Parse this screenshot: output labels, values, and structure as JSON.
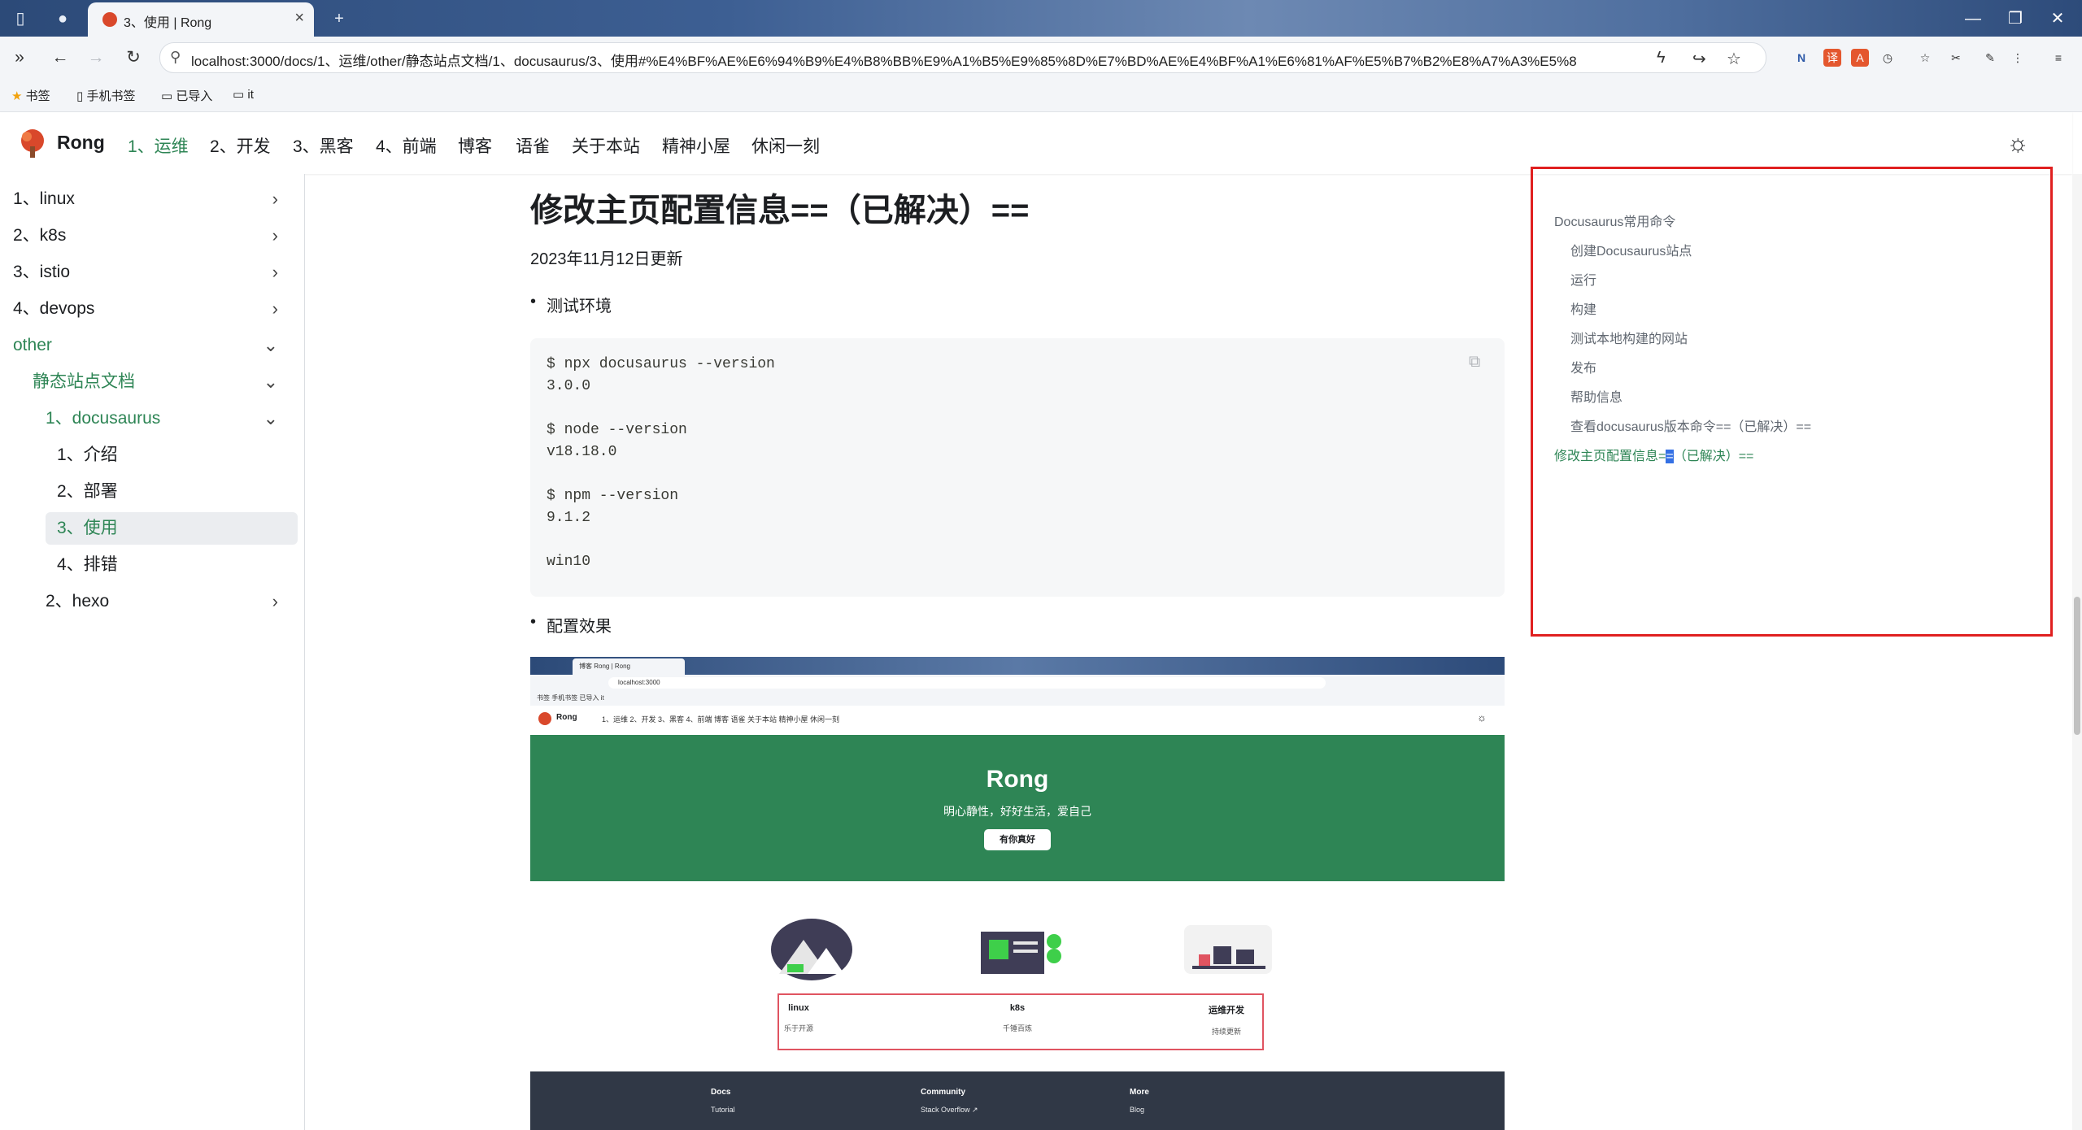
{
  "browser": {
    "tab_title": "3、使用 | Rong",
    "url": "localhost:3000/docs/1、运维/other/静态站点文档/1、docusaurus/3、使用#%E4%BF%AE%E6%94%B9%E4%B8%BB%E9%A1%B5%E9%85%8D%E7%BD%AE%E4%BF%A1%E6%81%AF%E5%B7%B2%E8%A7%A3%E5%8",
    "bookmarks": [
      "书签",
      "手机书签",
      "已导入",
      "it"
    ],
    "colors": {
      "tabbar": "#2c4a78",
      "toolbar": "#f3f5f8"
    }
  },
  "site": {
    "brand": "Rong",
    "nav": [
      "1、运维",
      "2、开发",
      "3、黑客",
      "4、前端",
      "博客",
      "语雀",
      "关于本站",
      "精神小屋",
      "休闲一刻"
    ],
    "accent": "#2e8555"
  },
  "sidebar": {
    "items": [
      {
        "label": "1、linux"
      },
      {
        "label": "2、k8s"
      },
      {
        "label": "3、istio"
      },
      {
        "label": "4、devops"
      },
      {
        "label": "other"
      },
      {
        "label": "静态站点文档"
      },
      {
        "label": "1、docusaurus"
      },
      {
        "label": "1、介绍"
      },
      {
        "label": "2、部署"
      },
      {
        "label": "3、使用"
      },
      {
        "label": "4、排错"
      },
      {
        "label": "2、hexo"
      }
    ]
  },
  "doc": {
    "heading": "修改主页配置信息==（已解决）==",
    "date": "2023年11月12日更新",
    "bullet1": "测试环境",
    "bullet2": "配置效果",
    "code_lines": [
      "$ npx docusaurus --version",
      "3.0.0",
      "",
      "$ node --version",
      "v18.18.0",
      "",
      "$ npm --version",
      "9.1.2",
      "",
      "win10"
    ]
  },
  "screenshot": {
    "tab": "博客 Rong | Rong",
    "url": "localhost:3000",
    "bookmarks": "书签   手机书签   已导入   it",
    "brand": "Rong",
    "nav": "1、运维    2、开发    3、黑客    4、前端    博客    语雀    关于本站    精神小屋    休闲一刻",
    "hero_title": "Rong",
    "hero_subtitle": "明心静性，好好生活，爱自己",
    "hero_button": "有你真好",
    "features": [
      {
        "title": "linux",
        "desc": "乐于开源"
      },
      {
        "title": "k8s",
        "desc": "千锤百炼"
      },
      {
        "title": "运维开发",
        "desc": "持续更新"
      }
    ],
    "footer": [
      {
        "head": "Docs",
        "items": "Tutorial"
      },
      {
        "head": "Community",
        "items": "Stack Overflow ↗"
      },
      {
        "head": "More",
        "items": "Blog"
      }
    ]
  },
  "toc": {
    "items": [
      "Docusaurus常用命令",
      "创建Docusaurus站点",
      "运行",
      "构建",
      "测试本地构建的网站",
      "发布",
      "帮助信息",
      "查看docusaurus版本命令==（已解决）=="
    ],
    "active_prefix": "修改主页配置信息=",
    "active_highlight": "=",
    "active_suffix": "（已解决）=="
  }
}
